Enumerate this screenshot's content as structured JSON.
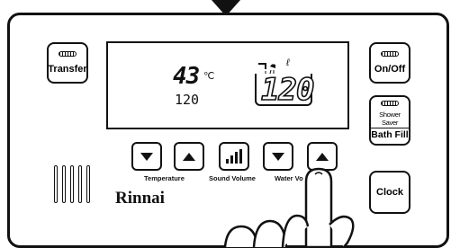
{
  "buttons": {
    "transfer": "Transfer",
    "on_off": "On/Off",
    "shower_saver": "Shower Saver",
    "bath_fill": "Bath Fill",
    "clock": "Clock"
  },
  "display": {
    "temperature_value": "43",
    "temperature_unit": "℃",
    "small_value": "120",
    "volume_value": "120",
    "volume_unit": "ℓ"
  },
  "controls": {
    "temperature_label": "Temperature",
    "sound_volume_label": "Sound Volume",
    "water_volume_label": "Water Vo"
  },
  "brand": "Rinnai",
  "icons": [
    "down-arrow-icon",
    "up-arrow-icon",
    "sound-bars-icon",
    "faucet-icon",
    "shower-icon",
    "hand-icon"
  ]
}
